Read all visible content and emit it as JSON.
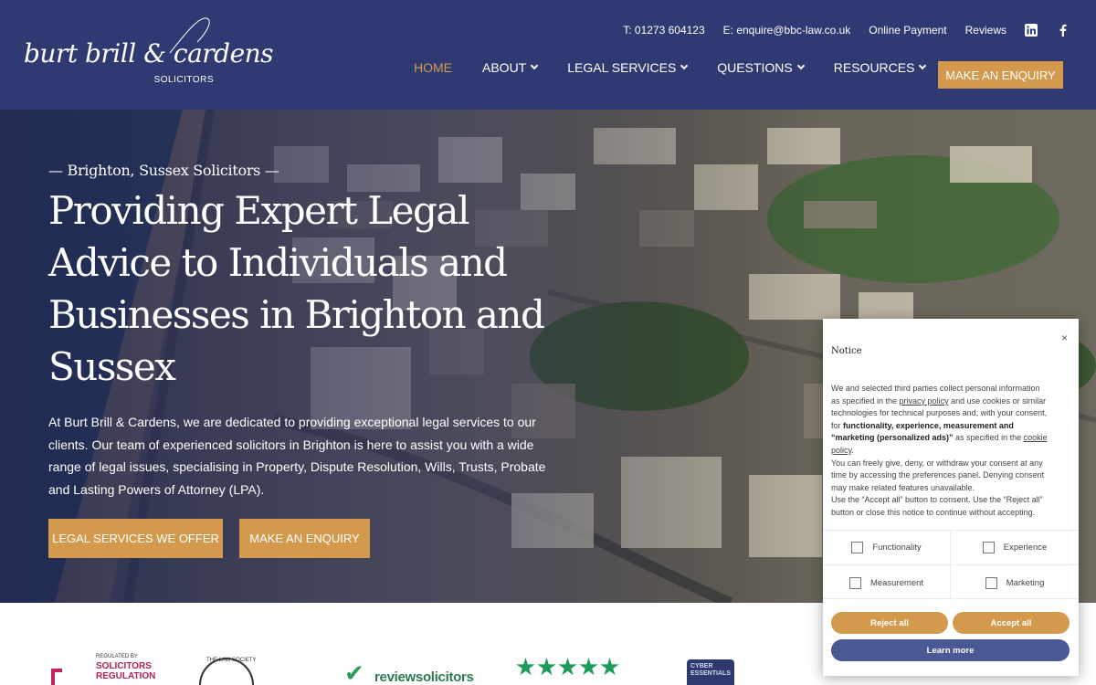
{
  "brand": {
    "logo_script": "burt brill & cardens",
    "logo_sub": "SOLICITORS"
  },
  "topbar": {
    "phone_prefix": "T:",
    "phone": "01273 604123",
    "email_prefix": "E:",
    "email": "enquire@bbc-law.co.uk",
    "online_payment": "Online Payment",
    "reviews": "Reviews",
    "linkedin_icon": "linkedin-icon",
    "facebook_icon": "facebook-icon"
  },
  "nav": {
    "items": [
      {
        "label": "HOME",
        "active": true,
        "dropdown": false
      },
      {
        "label": "ABOUT",
        "active": false,
        "dropdown": true
      },
      {
        "label": "LEGAL SERVICES",
        "active": false,
        "dropdown": true
      },
      {
        "label": "QUESTIONS",
        "active": false,
        "dropdown": true
      },
      {
        "label": "RESOURCES",
        "active": false,
        "dropdown": true
      }
    ],
    "cta": "MAKE AN ENQUIRY"
  },
  "hero": {
    "kicker": "— Brighton, Sussex Solicitors —",
    "title": "Providing Expert Legal Advice to Individuals and Businesses in Brighton and Sussex",
    "body": "At Burt Brill & Cardens, we are dedicated to providing exceptional legal services to our clients. Our team of experienced solicitors in Brighton is here to assist you with a wide range of legal issues, specialising in Property, Dispute Resolution, Wills, Trusts, Probate and Lasting Powers of Attorney (LPA).",
    "button_primary": "LEGAL SERVICES WE OFFER",
    "button_secondary": "MAKE AN ENQUIRY"
  },
  "logos": {
    "sra_small": "REGULATED BY",
    "sra_line1": "SOLICITORS",
    "sra_line2": "REGULATION",
    "law_society": "THE LAW SOCIETY",
    "review_solicitors": "reviewsolicitors",
    "cyber_line1": "CYBER",
    "cyber_line2": "ESSENTIALS",
    "rating_stars": 5
  },
  "cookie": {
    "close": "×",
    "title": "Notice",
    "text_1": "We and selected third parties collect personal information as specified in the ",
    "privacy_link": "privacy policy",
    "text_2": " and use cookies or similar technologies for technical purposes and, with your consent, for ",
    "purposes_bold": "functionality, experience, measurement and “marketing (personalized ads)”",
    "text_3": " as specified in the ",
    "cookie_link": "cookie policy",
    "text_4": ".",
    "text_5": "You can freely give, deny, or withdraw your consent at any time by accessing the preferences panel. Denying consent may make related features unavailable.",
    "text_6": "Use the “Accept all” button to consent. Use the “Reject all” button or close this notice to continue without accepting.",
    "options": [
      "Functionality",
      "Experience",
      "Measurement",
      "Marketing"
    ],
    "reject": "Reject all",
    "accept": "Accept all",
    "learn_more": "Learn more"
  },
  "colors": {
    "navy": "#303a72",
    "gold": "#d39a4e",
    "learn_more": "#4a5894"
  }
}
